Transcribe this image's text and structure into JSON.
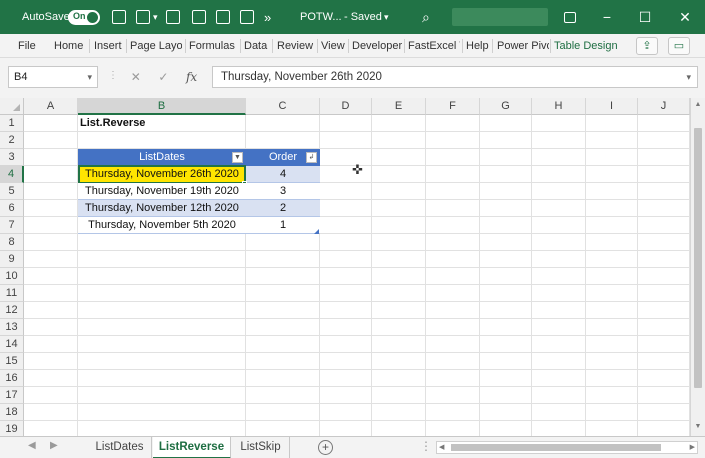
{
  "titlebar": {
    "autosave_label": "AutoSave",
    "autosave_state": "On",
    "doc_title": "POTW...",
    "saved_status": "- Saved",
    "more_glyph": "»",
    "colors": {
      "accent": "#217346"
    }
  },
  "ribbon": {
    "tabs": [
      "File",
      "Home",
      "Insert",
      "Page Layo",
      "Formulas",
      "Data",
      "Review",
      "View",
      "Developer",
      "FastExcel V",
      "Help",
      "Power Pivo",
      "Table Design"
    ],
    "active_tab": "Table Design"
  },
  "formula_bar": {
    "name_box": "B4",
    "formula": "Thursday, November 26th 2020",
    "fx_label": "fx"
  },
  "grid": {
    "columns": [
      "A",
      "B",
      "C",
      "D",
      "E",
      "F",
      "G",
      "H",
      "I",
      "J"
    ],
    "rows": [
      "1",
      "2",
      "3",
      "4",
      "5",
      "6",
      "7",
      "8",
      "9",
      "10",
      "11",
      "12",
      "13",
      "14",
      "15",
      "16",
      "17",
      "18",
      "19"
    ],
    "selected_column": "B",
    "selected_row": "4"
  },
  "sheet": {
    "title": "List.Reverse",
    "table": {
      "headers": [
        "ListDates",
        "Order"
      ],
      "rows": [
        {
          "date": "Thursday, November 26th 2020",
          "order": "4"
        },
        {
          "date": "Thursday, November 19th 2020",
          "order": "3"
        },
        {
          "date": "Thursday, November 12th 2020",
          "order": "2"
        },
        {
          "date": "Thursday, November 5th 2020",
          "order": "1"
        }
      ],
      "header_color": "#4472c4",
      "band_color": "#d9e1f2",
      "highlight_color": "#ffe500"
    }
  },
  "sheet_tabs": {
    "tabs": [
      "ListDates",
      "ListReverse",
      "ListSkip"
    ],
    "active": "ListReverse"
  }
}
